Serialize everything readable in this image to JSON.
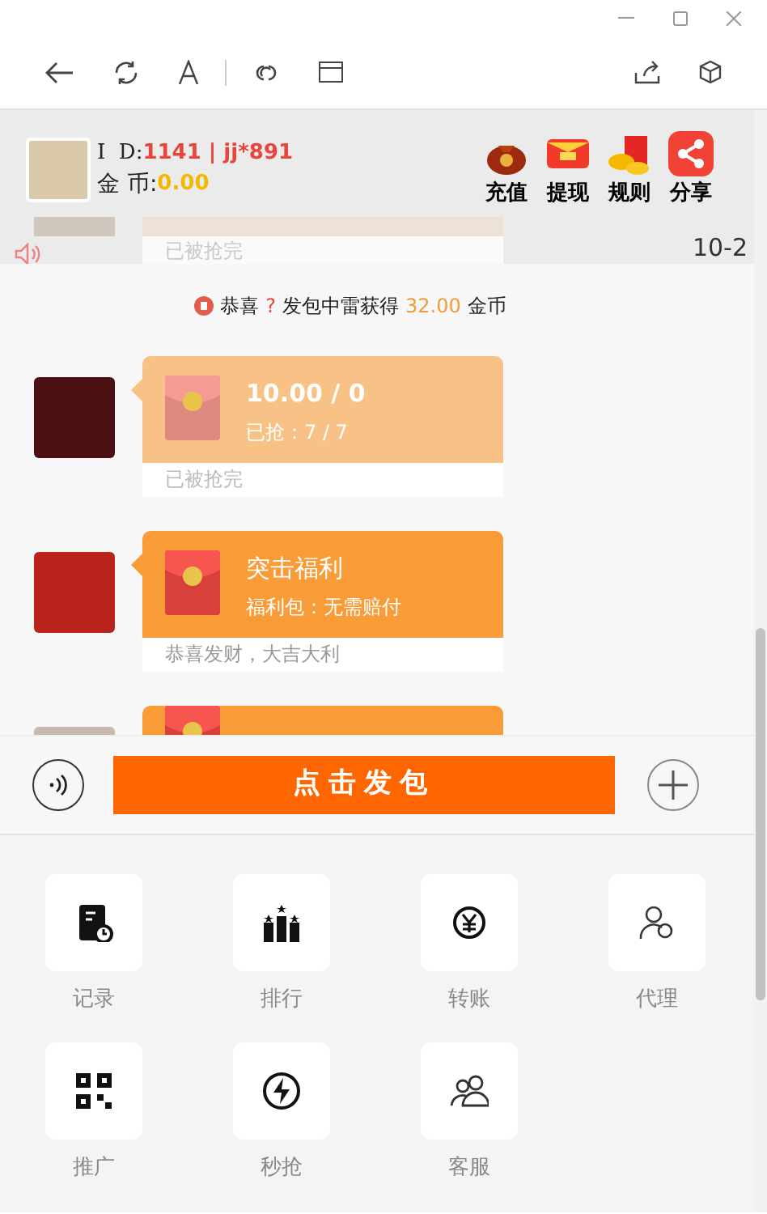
{
  "header": {
    "id_label": "I  D:",
    "id_value": "1141 | jj*891",
    "coins_label": "金 币:",
    "coins_value": "0.00",
    "actions": [
      {
        "label": "充值",
        "kind": "bag"
      },
      {
        "label": "提现",
        "kind": "envelope"
      },
      {
        "label": "规则",
        "kind": "gold"
      },
      {
        "label": "分享",
        "kind": "share"
      }
    ]
  },
  "previous_message": {
    "footer": "已被抢完",
    "time": "10-2"
  },
  "notice": {
    "parts": [
      {
        "text": "恭喜",
        "kind": "plain"
      },
      {
        "text": "?",
        "kind": "alert"
      },
      {
        "text": "发包中雷获得",
        "kind": "plain"
      },
      {
        "text": "32.00",
        "kind": "amount"
      },
      {
        "text": "金币",
        "kind": "plain"
      }
    ]
  },
  "messages": [
    {
      "title": "10.00 / 0",
      "subtitle": "已抢：7 / 7",
      "footer": "已被抢完",
      "opened": true
    },
    {
      "title": "突击福利",
      "subtitle": "福利包：无需赔付",
      "footer": "恭喜发财，大吉大利",
      "opened": false
    },
    {
      "opened": false
    }
  ],
  "composer": {
    "send_label": "点击发包"
  },
  "functions": [
    {
      "label": "记录",
      "kind": "record"
    },
    {
      "label": "排行",
      "kind": "rank"
    },
    {
      "label": "转账",
      "kind": "transfer"
    },
    {
      "label": "代理",
      "kind": "agent"
    },
    {
      "label": "推广",
      "kind": "qr"
    },
    {
      "label": "秒抢",
      "kind": "flash"
    },
    {
      "label": "客服",
      "kind": "service"
    }
  ]
}
